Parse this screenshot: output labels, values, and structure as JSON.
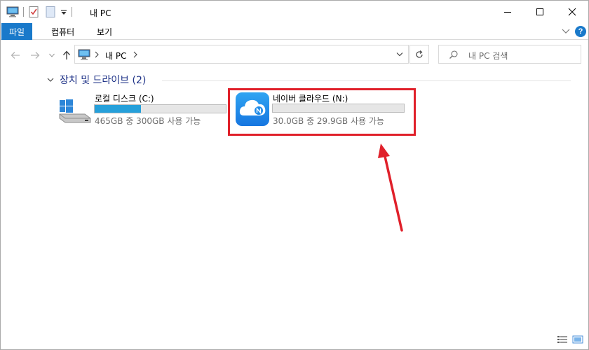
{
  "window": {
    "title": "내 PC"
  },
  "ribbon": {
    "tabs": [
      "파일",
      "컴퓨터",
      "보기"
    ],
    "help_label": "?"
  },
  "address": {
    "path": [
      "내 PC"
    ]
  },
  "search": {
    "placeholder": "내 PC 검색"
  },
  "group": {
    "title": "장치 및 드라이브 (2)"
  },
  "drives": [
    {
      "name": "로컬 디스크 (C:)",
      "info": "465GB 중 300GB 사용 가능",
      "used_fraction": 0.355,
      "icon": "windows-drive-icon"
    },
    {
      "name": "네이버 클라우드 (N:)",
      "info": "30.0GB 중 29.9GB 사용 가능",
      "used_fraction": 0.0,
      "icon": "naver-cloud-icon"
    }
  ],
  "colors": {
    "accent": "#1979ca",
    "bar_fill": "#26a0da",
    "annotation": "#e0202a",
    "group_title": "#1e3287"
  }
}
